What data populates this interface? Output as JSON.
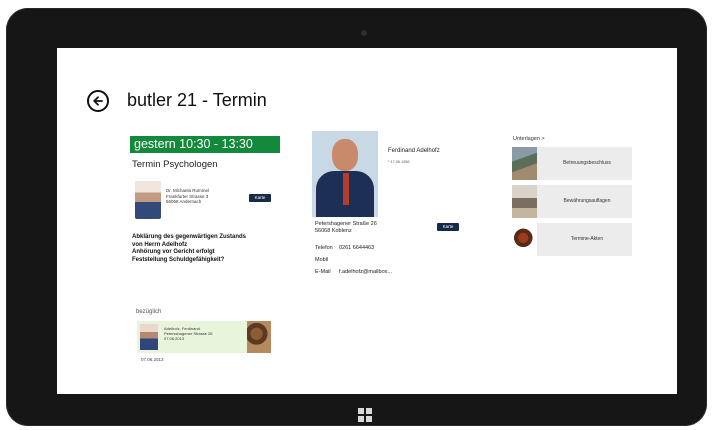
{
  "header": {
    "title": "butler 21 - Termin"
  },
  "appointment": {
    "time": "gestern  10:30 - 13:30",
    "type": "Termin Psychologen",
    "doctor_lines": [
      "Dr. Michaela Rummel",
      "Frankfurter Strasse 3",
      "56068 Andernach"
    ],
    "doctor_chip": "Karte",
    "description": [
      "Abklärung des gegenwärtigen Zustands",
      "von Herrn Adelhofz",
      "Anhörung vor Gericht erfolgt",
      "Feststellung Schuldgefähigkeit?"
    ]
  },
  "related": {
    "label": "bezüglich",
    "card_lines": [
      "Adelhofz, Ferdinand",
      "Petersshagener Strasse 26",
      "07.06.2013"
    ],
    "date": "07.06.2013"
  },
  "person": {
    "name": "Ferdinand Adelhofz",
    "subtitle": "* 17.06.1956",
    "address": [
      "Petershagener Straße 26",
      "56068 Koblenz"
    ],
    "address_chip": "Karte",
    "contacts": [
      {
        "key": "Telefon",
        "value": "0261 6644463"
      },
      {
        "key": "Mobil",
        "value": ""
      },
      {
        "key": "E-Mail",
        "value": "f.adelhofz@mailbox..."
      }
    ]
  },
  "documents": {
    "header": "Unterlagen >",
    "items": [
      {
        "label": "Betreuungsbeschluss"
      },
      {
        "label": "Bewährungsauflagen"
      },
      {
        "label": "Termine-Akten"
      }
    ]
  },
  "colors": {
    "accent_green": "#138a3b",
    "chip_navy": "#162a4a",
    "related_bg": "#e9f4dc",
    "tile_bg": "#ececec"
  }
}
